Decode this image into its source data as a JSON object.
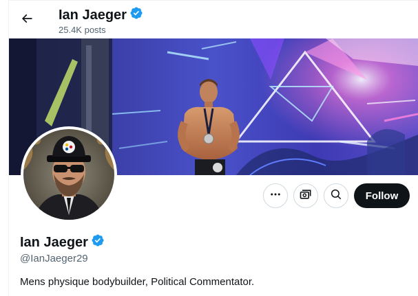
{
  "header": {
    "name": "Ian Jaeger",
    "posts": "25.4K posts"
  },
  "profile": {
    "name": "Ian Jaeger",
    "handle": "@IanJaeger29",
    "bio": "Mens physique bodybuilder, Political Commentator.",
    "verified": true
  },
  "actions": {
    "follow_label": "Follow",
    "more_icon": "more-icon",
    "subscribe_icon": "subscribe-icon",
    "search_icon": "search-icon"
  },
  "colors": {
    "verified_blue": "#1d9bf0",
    "follow_bg": "#0f1419",
    "secondary_text": "#536471"
  }
}
